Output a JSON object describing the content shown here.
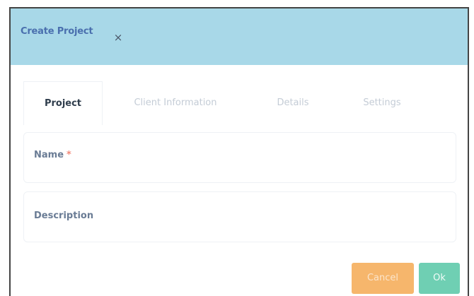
{
  "dialog": {
    "title": "Create Project",
    "close_label": "×"
  },
  "tabs": [
    {
      "label": "Project",
      "active": true
    },
    {
      "label": "Client Information",
      "active": false
    },
    {
      "label": "Details",
      "active": false
    },
    {
      "label": "Settings",
      "active": false
    }
  ],
  "form": {
    "name_label": "Name",
    "name_required_marker": "*",
    "description_label": "Description"
  },
  "footer": {
    "cancel_label": "Cancel",
    "ok_label": "Ok"
  },
  "colors": {
    "header_bg": "#a8d8e8",
    "title_text": "#4a6fae",
    "cancel_bg": "#f6b66c",
    "ok_bg": "#6fcfb3",
    "required": "#f28b7b"
  }
}
